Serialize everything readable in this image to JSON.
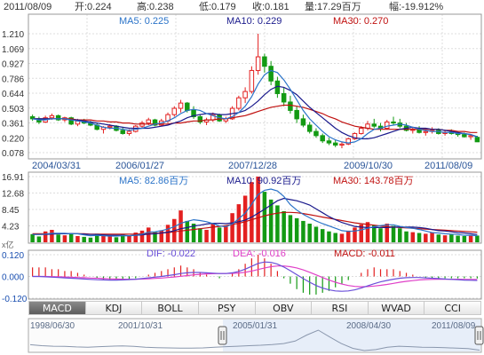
{
  "header": {
    "date": "2011/08/09",
    "open": "开:0.224",
    "high": "高:0.238",
    "low": "低:0.179",
    "close": "收:0.181",
    "volume": "量:17.29百万",
    "change": "幅:-19.912%"
  },
  "colors": {
    "up": "#e32020",
    "down": "#139a13",
    "ma5": "#2a73c8",
    "ma10": "#1a1a8c",
    "ma30": "#c0100f",
    "dif": "#6a4fd9",
    "dea": "#e040c8"
  },
  "price_panel": {
    "ma5": "MA5: 0.225",
    "ma10": "MA10: 0.229",
    "ma30": "MA30: 0.270",
    "y_ticks": [
      "1.210",
      "1.069",
      "0.927",
      "0.786",
      "0.644",
      "0.503",
      "0.361",
      "0.220",
      "0.078"
    ],
    "x_ticks": [
      "2004/03/31",
      "2006/01/27",
      "2007/12/28",
      "2009/10/30",
      "2011/08/09"
    ]
  },
  "volume_panel": {
    "ma5": "MA5: 82.86百万",
    "ma10": "MA10: 90.92百万",
    "ma30": "MA30: 143.78百万",
    "y_ticks": [
      "16.91",
      "12.68",
      "8.45",
      "4.23"
    ],
    "unit": "x亿"
  },
  "macd_panel": {
    "dif": "DIF: -0.022",
    "dea": "DEA: -0.016",
    "macd": "MACD: -0.011",
    "y_ticks": [
      "0.120",
      "0.000",
      "-0.120"
    ]
  },
  "tabs": [
    {
      "label": "MACD",
      "active": true
    },
    {
      "label": "KDJ",
      "active": false
    },
    {
      "label": "BOLL",
      "active": false
    },
    {
      "label": "PSY",
      "active": false
    },
    {
      "label": "OBV",
      "active": false
    },
    {
      "label": "RSI",
      "active": false
    },
    {
      "label": "WVAD",
      "active": false
    },
    {
      "label": "CCI",
      "active": false
    }
  ],
  "navigator": {
    "dates": [
      "1998/06/30",
      "2001/10/31",
      "2005/01/31",
      "2008/04/30",
      "2011/08/09"
    ],
    "selection_start": "2004/03/31",
    "selection_end": "2011/08/09"
  },
  "chart_data": {
    "type": "candlestick",
    "x_range": [
      "2004/03/31",
      "2011/08/09"
    ],
    "price": {
      "ylim": [
        0.078,
        1.21
      ],
      "candles_ohlc": [
        [
          0.42,
          0.44,
          0.38,
          0.4
        ],
        [
          0.4,
          0.42,
          0.35,
          0.37
        ],
        [
          0.37,
          0.43,
          0.36,
          0.41
        ],
        [
          0.41,
          0.45,
          0.39,
          0.43
        ],
        [
          0.43,
          0.44,
          0.38,
          0.39
        ],
        [
          0.39,
          0.42,
          0.37,
          0.41
        ],
        [
          0.41,
          0.42,
          0.34,
          0.35
        ],
        [
          0.35,
          0.4,
          0.33,
          0.38
        ],
        [
          0.38,
          0.4,
          0.35,
          0.36
        ],
        [
          0.36,
          0.38,
          0.33,
          0.34
        ],
        [
          0.34,
          0.36,
          0.29,
          0.3
        ],
        [
          0.3,
          0.33,
          0.26,
          0.32
        ],
        [
          0.32,
          0.35,
          0.3,
          0.33
        ],
        [
          0.33,
          0.34,
          0.28,
          0.29
        ],
        [
          0.29,
          0.32,
          0.25,
          0.26
        ],
        [
          0.26,
          0.3,
          0.24,
          0.28
        ],
        [
          0.28,
          0.34,
          0.27,
          0.33
        ],
        [
          0.33,
          0.38,
          0.31,
          0.36
        ],
        [
          0.36,
          0.41,
          0.34,
          0.39
        ],
        [
          0.39,
          0.4,
          0.33,
          0.34
        ],
        [
          0.34,
          0.4,
          0.33,
          0.38
        ],
        [
          0.38,
          0.46,
          0.36,
          0.44
        ],
        [
          0.44,
          0.52,
          0.42,
          0.5
        ],
        [
          0.5,
          0.58,
          0.46,
          0.55
        ],
        [
          0.55,
          0.56,
          0.46,
          0.48
        ],
        [
          0.48,
          0.52,
          0.4,
          0.42
        ],
        [
          0.42,
          0.44,
          0.35,
          0.37
        ],
        [
          0.37,
          0.41,
          0.34,
          0.39
        ],
        [
          0.39,
          0.46,
          0.37,
          0.44
        ],
        [
          0.44,
          0.45,
          0.37,
          0.38
        ],
        [
          0.38,
          0.42,
          0.36,
          0.4
        ],
        [
          0.4,
          0.52,
          0.39,
          0.5
        ],
        [
          0.5,
          0.62,
          0.48,
          0.6
        ],
        [
          0.6,
          0.7,
          0.55,
          0.66
        ],
        [
          0.66,
          0.9,
          0.64,
          0.86
        ],
        [
          0.86,
          1.21,
          0.82,
          0.99
        ],
        [
          0.99,
          1.02,
          0.84,
          0.9
        ],
        [
          0.9,
          0.95,
          0.72,
          0.76
        ],
        [
          0.76,
          0.8,
          0.6,
          0.64
        ],
        [
          0.64,
          0.7,
          0.52,
          0.56
        ],
        [
          0.56,
          0.62,
          0.45,
          0.48
        ],
        [
          0.48,
          0.52,
          0.36,
          0.4
        ],
        [
          0.4,
          0.44,
          0.32,
          0.34
        ],
        [
          0.34,
          0.37,
          0.26,
          0.28
        ],
        [
          0.28,
          0.31,
          0.22,
          0.24
        ],
        [
          0.24,
          0.26,
          0.17,
          0.19
        ],
        [
          0.19,
          0.22,
          0.15,
          0.17
        ],
        [
          0.17,
          0.2,
          0.13,
          0.15
        ],
        [
          0.15,
          0.18,
          0.12,
          0.16
        ],
        [
          0.16,
          0.22,
          0.15,
          0.21
        ],
        [
          0.21,
          0.27,
          0.2,
          0.26
        ],
        [
          0.26,
          0.33,
          0.25,
          0.31
        ],
        [
          0.31,
          0.38,
          0.29,
          0.35
        ],
        [
          0.35,
          0.4,
          0.31,
          0.33
        ],
        [
          0.33,
          0.36,
          0.28,
          0.31
        ],
        [
          0.31,
          0.39,
          0.3,
          0.37
        ],
        [
          0.37,
          0.42,
          0.34,
          0.36
        ],
        [
          0.36,
          0.4,
          0.31,
          0.33
        ],
        [
          0.33,
          0.36,
          0.28,
          0.29
        ],
        [
          0.29,
          0.32,
          0.26,
          0.3
        ],
        [
          0.3,
          0.33,
          0.26,
          0.27
        ],
        [
          0.27,
          0.3,
          0.24,
          0.28
        ],
        [
          0.28,
          0.32,
          0.26,
          0.29
        ],
        [
          0.29,
          0.31,
          0.25,
          0.26
        ],
        [
          0.26,
          0.29,
          0.24,
          0.27
        ],
        [
          0.27,
          0.3,
          0.25,
          0.26
        ],
        [
          0.26,
          0.28,
          0.23,
          0.25
        ],
        [
          0.25,
          0.27,
          0.22,
          0.23
        ],
        [
          0.23,
          0.25,
          0.2,
          0.24
        ],
        [
          0.224,
          0.238,
          0.179,
          0.181
        ]
      ],
      "ma5_line": [
        0.4,
        0.39,
        0.39,
        0.4,
        0.4,
        0.4,
        0.39,
        0.38,
        0.37,
        0.36,
        0.34,
        0.32,
        0.31,
        0.31,
        0.3,
        0.29,
        0.3,
        0.31,
        0.33,
        0.35,
        0.36,
        0.38,
        0.41,
        0.45,
        0.48,
        0.49,
        0.48,
        0.45,
        0.43,
        0.41,
        0.4,
        0.42,
        0.46,
        0.52,
        0.61,
        0.73,
        0.82,
        0.86,
        0.84,
        0.77,
        0.68,
        0.58,
        0.48,
        0.4,
        0.34,
        0.28,
        0.23,
        0.2,
        0.18,
        0.17,
        0.18,
        0.21,
        0.26,
        0.3,
        0.31,
        0.33,
        0.34,
        0.35,
        0.34,
        0.32,
        0.3,
        0.29,
        0.28,
        0.28,
        0.27,
        0.27,
        0.26,
        0.26,
        0.25,
        0.225
      ],
      "ma10_line": [
        0.4,
        0.4,
        0.4,
        0.4,
        0.4,
        0.4,
        0.39,
        0.39,
        0.38,
        0.37,
        0.36,
        0.35,
        0.34,
        0.33,
        0.32,
        0.31,
        0.31,
        0.31,
        0.31,
        0.32,
        0.33,
        0.34,
        0.36,
        0.38,
        0.41,
        0.43,
        0.44,
        0.45,
        0.45,
        0.44,
        0.44,
        0.45,
        0.46,
        0.48,
        0.52,
        0.57,
        0.63,
        0.68,
        0.71,
        0.7,
        0.67,
        0.63,
        0.57,
        0.51,
        0.46,
        0.41,
        0.36,
        0.31,
        0.27,
        0.24,
        0.22,
        0.21,
        0.21,
        0.22,
        0.24,
        0.26,
        0.28,
        0.3,
        0.31,
        0.32,
        0.31,
        0.31,
        0.3,
        0.3,
        0.29,
        0.28,
        0.27,
        0.26,
        0.25,
        0.229
      ],
      "ma30_line": [
        0.4,
        0.4,
        0.4,
        0.4,
        0.4,
        0.4,
        0.4,
        0.39,
        0.39,
        0.39,
        0.38,
        0.38,
        0.37,
        0.37,
        0.36,
        0.36,
        0.35,
        0.35,
        0.35,
        0.35,
        0.35,
        0.35,
        0.36,
        0.36,
        0.37,
        0.38,
        0.38,
        0.39,
        0.39,
        0.4,
        0.4,
        0.41,
        0.42,
        0.43,
        0.45,
        0.47,
        0.49,
        0.51,
        0.52,
        0.53,
        0.53,
        0.52,
        0.51,
        0.49,
        0.47,
        0.45,
        0.42,
        0.4,
        0.37,
        0.35,
        0.33,
        0.32,
        0.31,
        0.3,
        0.3,
        0.3,
        0.3,
        0.3,
        0.3,
        0.3,
        0.3,
        0.3,
        0.3,
        0.3,
        0.29,
        0.29,
        0.28,
        0.28,
        0.27,
        0.27
      ]
    },
    "volume": {
      "ylim": [
        0,
        16.91
      ],
      "values": [
        2.1,
        1.5,
        2.8,
        3.2,
        2.0,
        1.8,
        2.4,
        1.6,
        1.4,
        1.2,
        2.2,
        1.8,
        1.5,
        1.3,
        2.0,
        1.6,
        2.5,
        3.0,
        3.8,
        2.6,
        3.0,
        4.5,
        6.0,
        8.2,
        5.5,
        4.8,
        3.6,
        3.2,
        5.0,
        3.8,
        4.2,
        7.5,
        9.8,
        12.0,
        15.5,
        16.91,
        13.0,
        11.0,
        9.5,
        8.0,
        7.0,
        6.2,
        5.5,
        4.8,
        4.0,
        3.4,
        2.8,
        2.4,
        2.2,
        3.0,
        3.8,
        4.6,
        5.2,
        4.4,
        3.6,
        4.8,
        4.2,
        3.6,
        2.8,
        2.6,
        2.4,
        2.2,
        2.6,
        2.0,
        1.8,
        2.0,
        1.7,
        1.6,
        1.9,
        1.73
      ],
      "ma5_line": [
        2.0,
        2.0,
        2.1,
        2.3,
        2.3,
        2.3,
        2.2,
        2.2,
        1.9,
        1.7,
        1.8,
        1.7,
        1.6,
        1.6,
        1.7,
        1.7,
        1.8,
        2.1,
        2.6,
        2.7,
        3.0,
        3.4,
        4.0,
        4.9,
        5.4,
        5.8,
        5.6,
        5.3,
        4.8,
        4.2,
        4.0,
        4.7,
        6.1,
        7.5,
        9.8,
        12.3,
        13.4,
        13.7,
        13.2,
        11.8,
        9.7,
        8.3,
        7.2,
        6.3,
        5.5,
        4.8,
        4.2,
        3.6,
        3.0,
        2.8,
        2.9,
        3.2,
        3.6,
        4.0,
        4.3,
        4.5,
        4.5,
        4.1,
        3.8,
        3.6,
        3.3,
        2.9,
        2.5,
        2.4,
        2.2,
        2.1,
        2.0,
        1.8,
        1.8,
        1.7
      ],
      "ma10_line": [
        2.0,
        2.0,
        2.0,
        2.1,
        2.2,
        2.2,
        2.2,
        2.2,
        2.1,
        2.0,
        2.0,
        1.9,
        1.8,
        1.8,
        1.8,
        1.7,
        1.8,
        1.9,
        2.1,
        2.2,
        2.4,
        2.6,
        3.0,
        3.5,
        3.8,
        4.2,
        4.4,
        4.7,
        4.9,
        4.9,
        4.8,
        5.0,
        5.3,
        5.7,
        6.5,
        7.5,
        8.5,
        9.6,
        10.7,
        11.3,
        11.0,
        10.7,
        10.2,
        9.6,
        8.6,
        7.6,
        6.6,
        5.8,
        5.1,
        4.6,
        4.1,
        3.9,
        3.8,
        3.8,
        3.8,
        3.8,
        3.9,
        3.9,
        3.9,
        3.9,
        3.8,
        3.6,
        3.3,
        3.0,
        2.9,
        2.7,
        2.5,
        2.4,
        2.2,
        2.0
      ],
      "ma30_line": [
        2.2,
        2.2,
        2.2,
        2.2,
        2.2,
        2.2,
        2.2,
        2.2,
        2.2,
        2.1,
        2.1,
        2.1,
        2.1,
        2.1,
        2.1,
        2.1,
        2.1,
        2.2,
        2.2,
        2.3,
        2.4,
        2.5,
        2.7,
        2.9,
        3.1,
        3.3,
        3.5,
        3.7,
        3.9,
        4.1,
        4.3,
        4.6,
        4.9,
        5.3,
        5.8,
        6.3,
        6.8,
        7.2,
        7.5,
        7.7,
        7.7,
        7.6,
        7.4,
        7.1,
        6.8,
        6.5,
        6.2,
        5.9,
        5.6,
        5.3,
        5.0,
        4.8,
        4.6,
        4.4,
        4.2,
        4.0,
        3.9,
        3.8,
        3.7,
        3.6,
        3.5,
        3.4,
        3.3,
        3.2,
        3.1,
        3.0,
        2.9,
        2.8,
        2.7,
        2.6
      ]
    },
    "macd": {
      "ylim": [
        -0.12,
        0.12
      ],
      "hist": [
        0.05,
        0.05,
        0.05,
        0.04,
        0.04,
        0.03,
        0.03,
        0.02,
        0.01,
        0.0,
        -0.01,
        -0.02,
        -0.02,
        -0.02,
        -0.02,
        -0.02,
        -0.01,
        0.0,
        0.01,
        0.02,
        0.03,
        0.04,
        0.05,
        0.06,
        0.05,
        0.04,
        0.02,
        0.01,
        0.0,
        -0.01,
        0.0,
        0.02,
        0.04,
        0.07,
        0.1,
        0.12,
        0.1,
        0.07,
        0.03,
        -0.01,
        -0.04,
        -0.07,
        -0.09,
        -0.1,
        -0.1,
        -0.09,
        -0.08,
        -0.06,
        -0.04,
        -0.02,
        0.0,
        0.02,
        0.04,
        0.05,
        0.04,
        0.04,
        0.04,
        0.03,
        0.02,
        0.01,
        0.0,
        -0.01,
        -0.01,
        -0.01,
        -0.01,
        -0.01,
        -0.01,
        -0.01,
        -0.01,
        -0.011
      ],
      "dif_line": [
        0.0,
        0.0,
        -0.002,
        -0.004,
        -0.006,
        -0.008,
        -0.01,
        -0.012,
        -0.014,
        -0.016,
        -0.018,
        -0.019,
        -0.02,
        -0.02,
        -0.019,
        -0.017,
        -0.015,
        -0.012,
        -0.008,
        -0.004,
        0.0,
        0.005,
        0.01,
        0.016,
        0.02,
        0.022,
        0.022,
        0.02,
        0.018,
        0.016,
        0.016,
        0.02,
        0.028,
        0.04,
        0.056,
        0.072,
        0.08,
        0.078,
        0.068,
        0.052,
        0.032,
        0.01,
        -0.012,
        -0.032,
        -0.05,
        -0.064,
        -0.074,
        -0.08,
        -0.082,
        -0.08,
        -0.074,
        -0.064,
        -0.052,
        -0.04,
        -0.03,
        -0.022,
        -0.015,
        -0.01,
        -0.007,
        -0.006,
        -0.006,
        -0.008,
        -0.01,
        -0.012,
        -0.014,
        -0.016,
        -0.018,
        -0.02,
        -0.021,
        -0.022
      ],
      "dea_line": [
        0.0,
        0.0,
        0.0,
        -0.001,
        -0.002,
        -0.003,
        -0.004,
        -0.006,
        -0.007,
        -0.009,
        -0.01,
        -0.012,
        -0.013,
        -0.014,
        -0.015,
        -0.015,
        -0.015,
        -0.014,
        -0.013,
        -0.011,
        -0.009,
        -0.006,
        -0.003,
        0.001,
        0.005,
        0.009,
        0.012,
        0.014,
        0.015,
        0.016,
        0.016,
        0.017,
        0.019,
        0.023,
        0.03,
        0.038,
        0.047,
        0.054,
        0.058,
        0.058,
        0.054,
        0.047,
        0.036,
        0.023,
        0.009,
        -0.006,
        -0.02,
        -0.032,
        -0.042,
        -0.05,
        -0.055,
        -0.057,
        -0.056,
        -0.053,
        -0.049,
        -0.044,
        -0.038,
        -0.032,
        -0.027,
        -0.023,
        -0.019,
        -0.017,
        -0.016,
        -0.015,
        -0.015,
        -0.015,
        -0.015,
        -0.016,
        -0.016,
        -0.016
      ]
    },
    "navigator_series": [
      0.4,
      0.36,
      0.34,
      0.33,
      0.31,
      0.3,
      0.32,
      0.34,
      0.35,
      0.33,
      0.3,
      0.28,
      0.27,
      0.26,
      0.26,
      0.27,
      0.3,
      0.32,
      0.34,
      0.36,
      0.38,
      0.41,
      0.45,
      0.55,
      0.8,
      1.0,
      0.72,
      0.45,
      0.25,
      0.16,
      0.2,
      0.3,
      0.34,
      0.32,
      0.3,
      0.29,
      0.28,
      0.26,
      0.24,
      0.18
    ]
  }
}
